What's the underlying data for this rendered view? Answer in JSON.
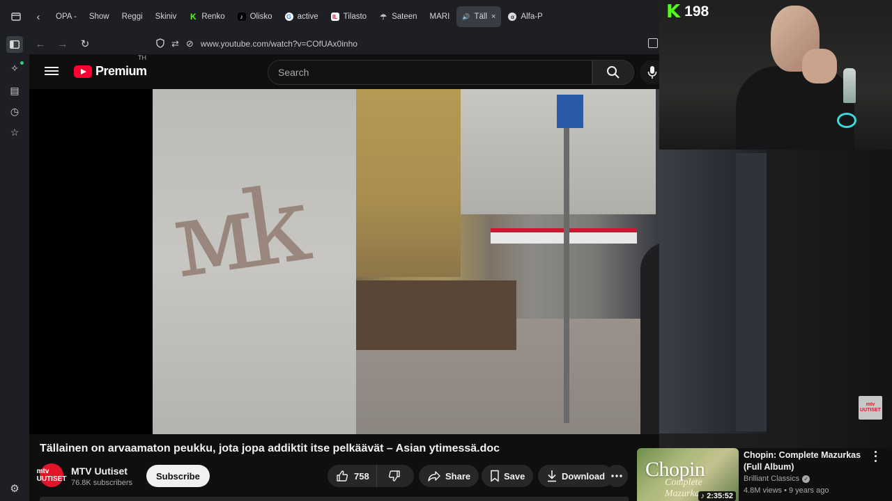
{
  "browser": {
    "tabs": [
      {
        "label": "OPA -",
        "icon": "youtube-icon",
        "active": false
      },
      {
        "label": "Show",
        "icon": "youtube-icon",
        "active": false
      },
      {
        "label": "Reggi",
        "icon": "youtube-icon",
        "active": false
      },
      {
        "label": "Skiniv",
        "icon": "youtube-icon",
        "active": false
      },
      {
        "label": "Renko",
        "icon": "kick-icon",
        "active": false
      },
      {
        "label": "Olisko",
        "icon": "tiktok-icon",
        "active": false
      },
      {
        "label": "active",
        "icon": "google-icon",
        "active": false
      },
      {
        "label": "Tilasto",
        "icon": "iltalehti-icon",
        "active": false
      },
      {
        "label": "Sateen",
        "icon": "weather-icon",
        "active": false
      },
      {
        "label": "MARI",
        "icon": "youtube-icon",
        "active": false
      },
      {
        "label": "Täll",
        "icon": "youtube-icon",
        "active": true
      },
      {
        "label": "Alfa-P",
        "icon": "alfa-icon",
        "active": false
      }
    ],
    "url": "www.youtube.com/watch?v=COfUAx0inho"
  },
  "youtube": {
    "logo_text": "Premium",
    "country_code": "TH",
    "search_placeholder": "Search",
    "video": {
      "title": "Tällainen on arvaamaton peukku, jota jopa addiktit itse pelkäävät – Asian ytimessä.doc",
      "watermark": "mtv UUTISET"
    },
    "channel": {
      "name": "MTV Uutiset",
      "subscribers": "76.8K subscribers",
      "avatar_text": "mtv UUTISET",
      "subscribe_label": "Subscribe"
    },
    "actions": {
      "likes": "758",
      "share_label": "Share",
      "save_label": "Save",
      "download_label": "Download"
    },
    "recommended": {
      "title": "Chopin: Complete Mazurkas (Full Album)",
      "channel": "Brilliant Classics",
      "meta": "4.8M views • 9 years ago",
      "duration": "2:35:52",
      "thumb_title": "Chopin",
      "thumb_subtitle": "Complete Mazurkas"
    }
  },
  "overlay": {
    "kick_count": "198"
  },
  "colors": {
    "yt_red": "#ff0033",
    "kick_green": "#53fc18",
    "bg": "#0f0f0f"
  }
}
